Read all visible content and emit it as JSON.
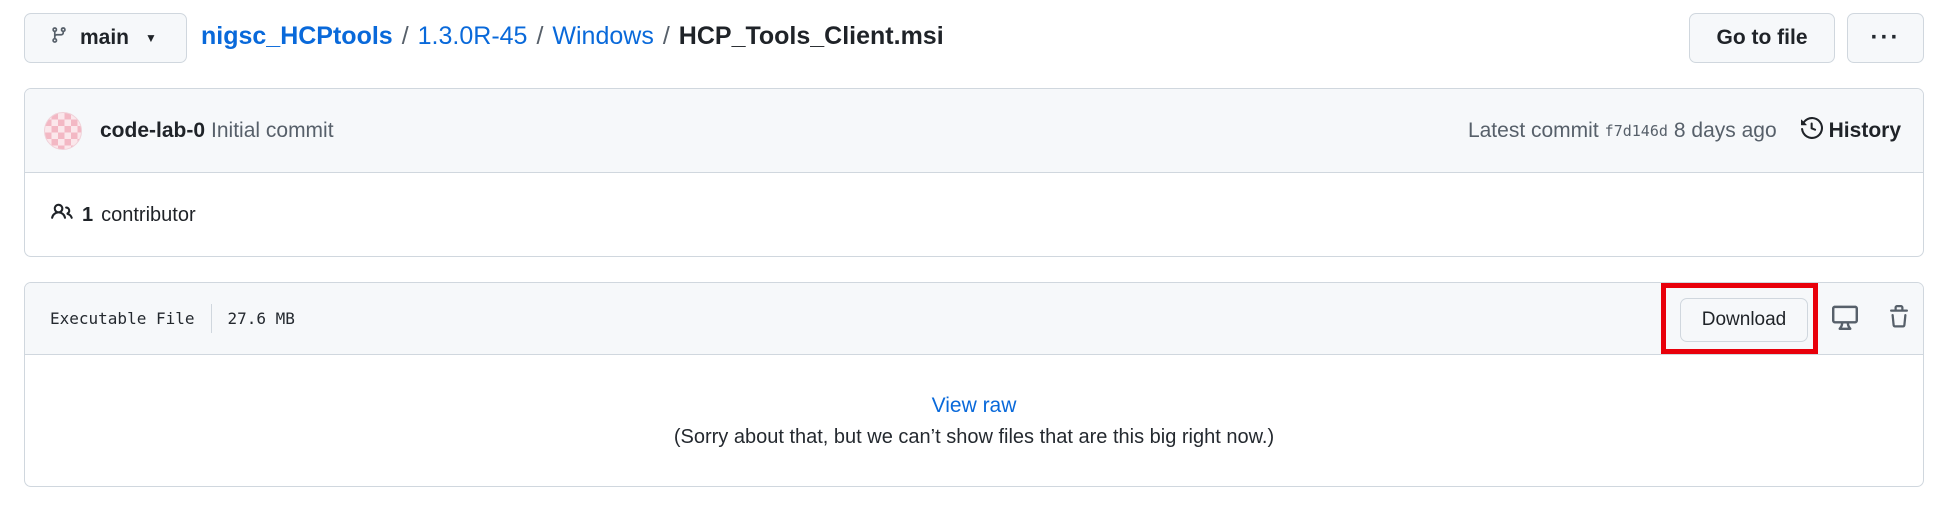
{
  "topbar": {
    "branch": "main",
    "breadcrumb": {
      "repo": "nigsc_HCPtools",
      "folder1": "1.3.0R-45",
      "folder2": "Windows",
      "separator": "/",
      "file": "HCP_Tools_Client.msi"
    },
    "goto_file_label": "Go to file",
    "more_label": "···"
  },
  "commit": {
    "author": "code-lab-0",
    "message": "Initial commit",
    "latest_label": "Latest commit",
    "sha": "f7d146d",
    "time": "8 days ago",
    "history_label": "History"
  },
  "contributors": {
    "count": "1",
    "label": "contributor"
  },
  "file": {
    "type": "Executable File",
    "size": "27.6 MB",
    "download_label": "Download",
    "view_raw_label": "View raw",
    "too_big_message": "(Sorry about that, but we can’t show files that are this big right now.)"
  },
  "colors": {
    "link": "#0969da",
    "highlight": "#e8000b",
    "border": "#d0d7de",
    "header_bg": "#f6f8fa"
  },
  "icons": {
    "branch": "git-branch-icon",
    "history": "history-icon",
    "people": "people-icon",
    "desktop": "desktop-icon",
    "trash": "trash-icon"
  }
}
